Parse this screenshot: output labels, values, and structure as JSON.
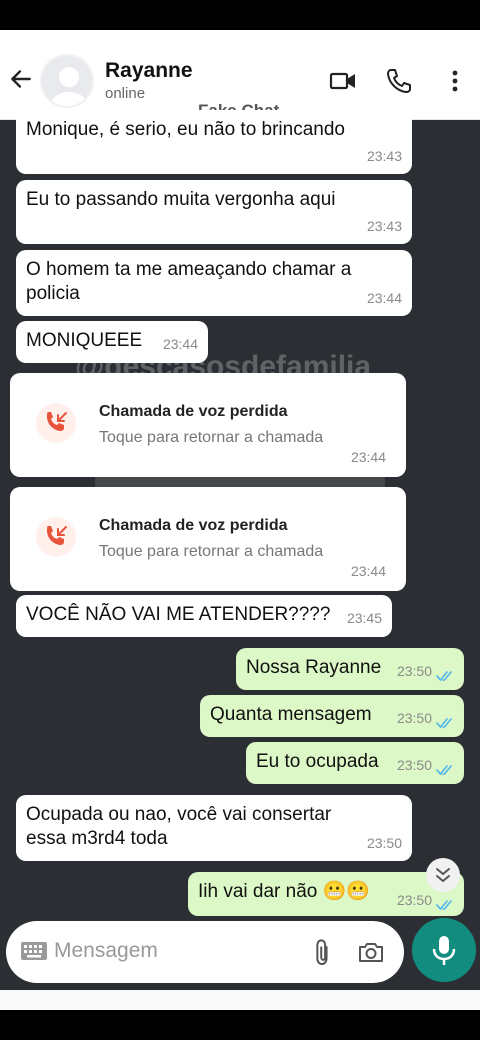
{
  "header": {
    "contact_name": "Rayanne",
    "status": "online",
    "overlay_label": "Fake Chat"
  },
  "watermark": {
    "text": "@descasosdefamilia"
  },
  "messages": [
    {
      "text": "Monique, é serio, eu não to brincando",
      "time": "23:43",
      "dir": "in"
    },
    {
      "text": "Eu to passando muita vergonha aqui",
      "time": "23:43",
      "dir": "in"
    },
    {
      "text": "O homem ta me ameaçando chamar a policia",
      "time": "23:44",
      "dir": "in"
    },
    {
      "text": "MONIQUEEE",
      "time": "23:44",
      "dir": "in"
    },
    {
      "text": "VOCÊ NÃO VAI ME ATENDER????",
      "time": "23:45",
      "dir": "in"
    },
    {
      "text": "Nossa Rayanne",
      "time": "23:50",
      "dir": "out"
    },
    {
      "text": "Quanta mensagem",
      "time": "23:50",
      "dir": "out"
    },
    {
      "text": "Eu to ocupada",
      "time": "23:50",
      "dir": "out"
    },
    {
      "text": "Ocupada ou nao, você vai consertar essa m3rd4 toda",
      "time": "23:50",
      "dir": "in"
    },
    {
      "text": "Iih vai dar não 😬😬",
      "time": "23:50",
      "dir": "out"
    }
  ],
  "calls": [
    {
      "title": "Chamada de voz perdida",
      "subtitle": "Toque para retornar a chamada",
      "time": "23:44"
    },
    {
      "title": "Chamada de voz perdida",
      "subtitle": "Toque para retornar a chamada",
      "time": "23:44"
    }
  ],
  "input": {
    "placeholder": "Mensagem"
  },
  "icons": {
    "back": "arrow-left-icon",
    "video": "video-call-icon",
    "phone": "phone-icon",
    "menu": "more-vert-icon",
    "missed_call": "missed-call-icon",
    "keyboard": "keyboard-icon",
    "attach": "paperclip-icon",
    "camera": "camera-icon",
    "mic": "mic-icon",
    "scroll_down": "double-chevron-down-icon",
    "read_receipt": "double-check-icon"
  },
  "colors": {
    "chat_bg": "#2b2f33",
    "incoming": "#ffffff",
    "outgoing": "#dcf8c6",
    "accent": "#128c7e",
    "read_ticks": "#4fb6ec",
    "missed_call": "#e8533c"
  }
}
